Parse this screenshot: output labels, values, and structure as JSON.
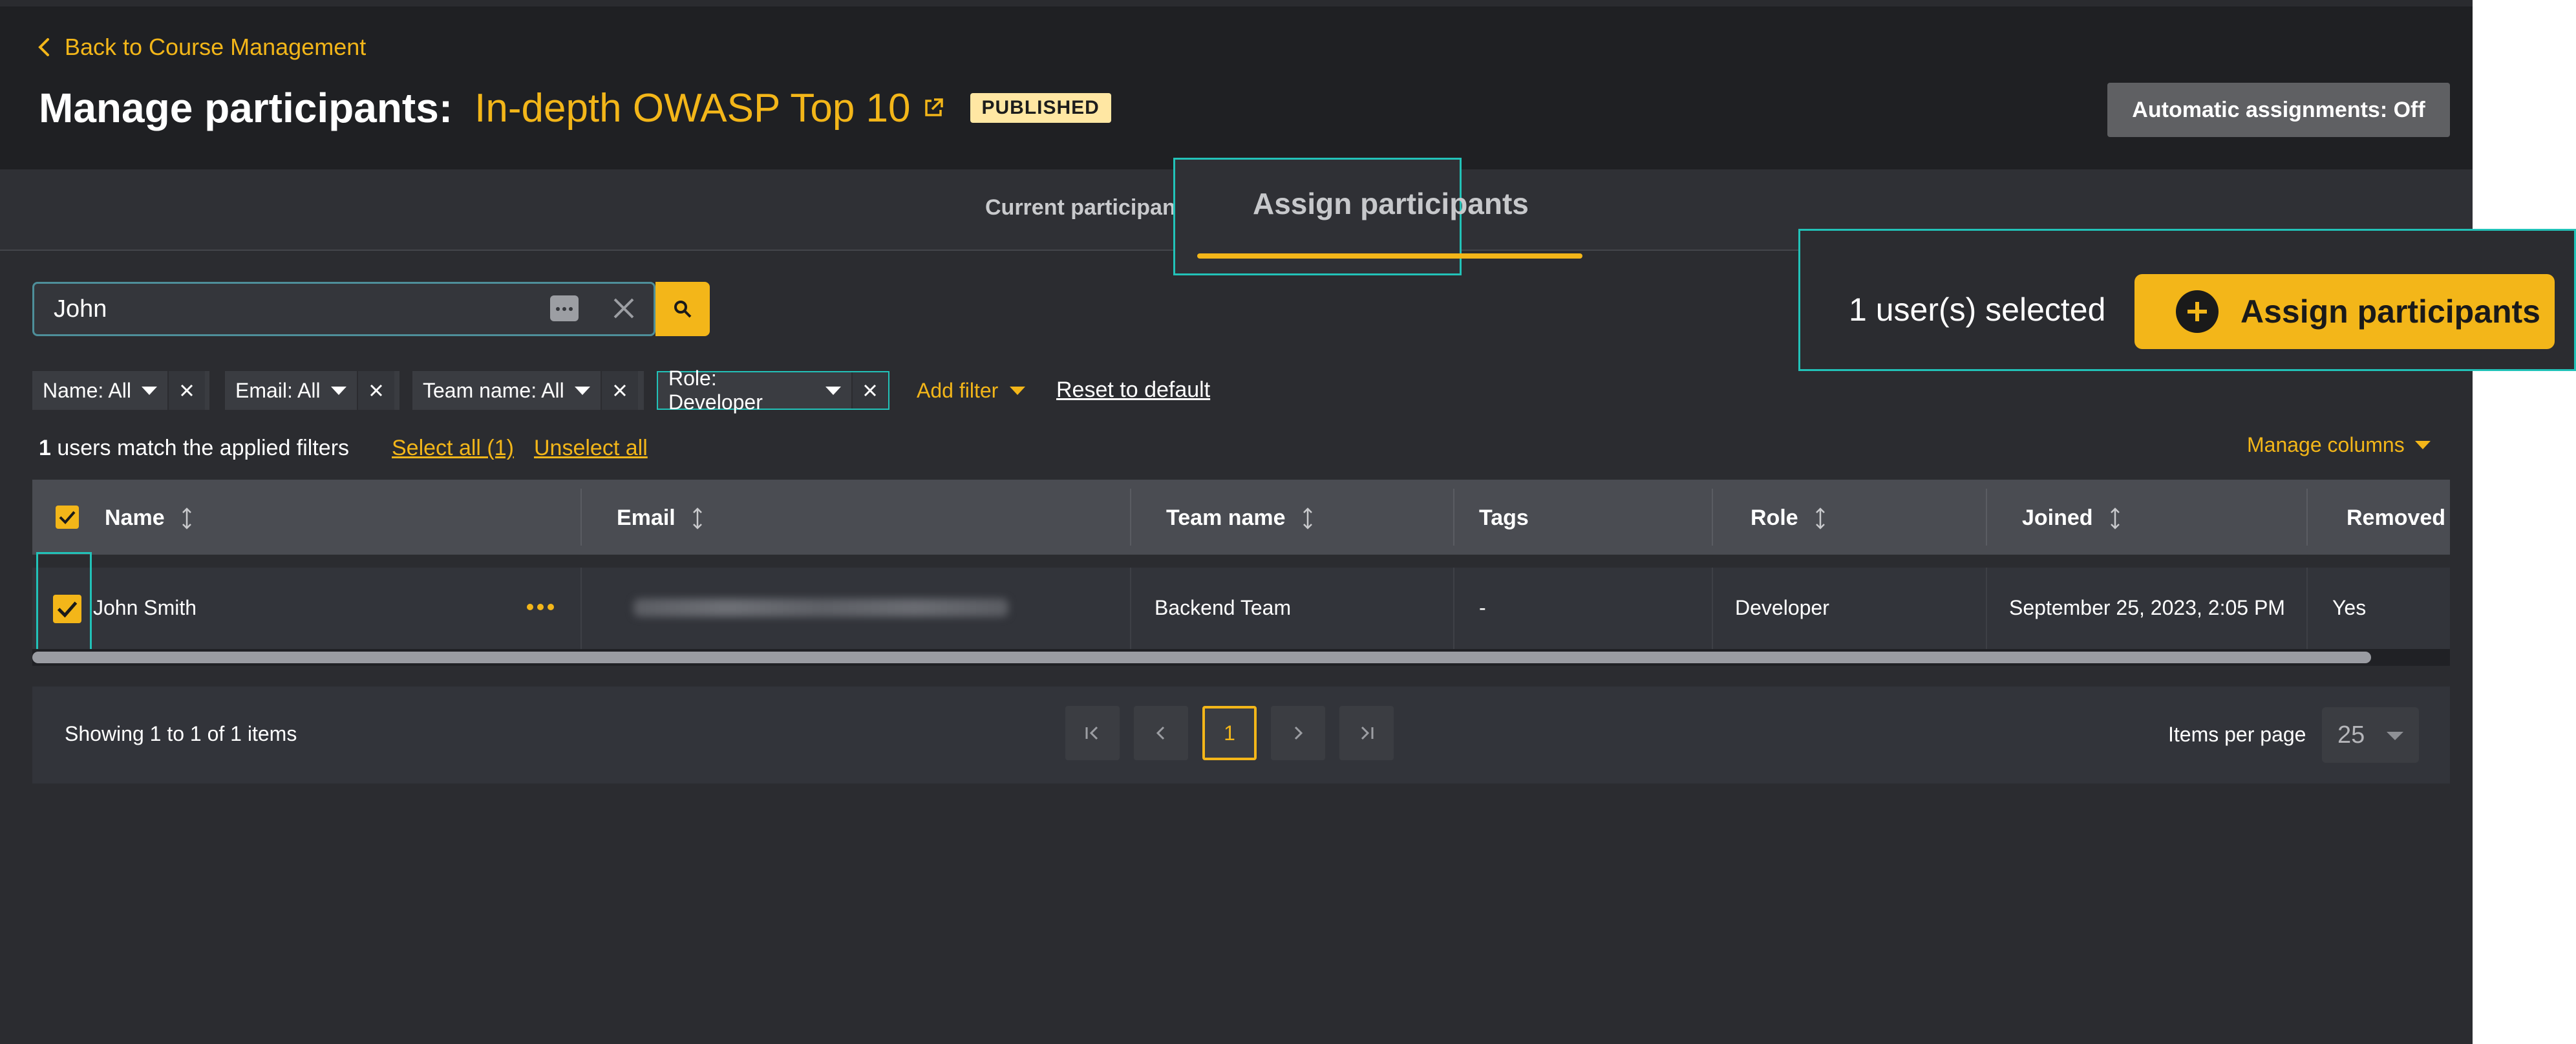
{
  "header": {
    "back_label": "Back to Course Management",
    "title": "Manage participants:",
    "course_name": "In-depth OWASP Top 10",
    "badge": "PUBLISHED",
    "auto_assign_label": "Automatic assignments: Off"
  },
  "tabs": {
    "current": "Current participants",
    "assign": "Assign participants"
  },
  "search": {
    "value": "John"
  },
  "filters": [
    {
      "label": "Name: All"
    },
    {
      "label": "Email: All"
    },
    {
      "label": "Team name: All"
    },
    {
      "label": "Role: Developer"
    }
  ],
  "add_filter": "Add filter",
  "reset": "Reset to default",
  "selection": {
    "selected_text": "1 user(s) selected",
    "assign_button": "Assign participants"
  },
  "results": {
    "count": "1",
    "text": " users match the applied filters",
    "select_all": "Select all (1)",
    "unselect_all": "Unselect all",
    "manage_columns": "Manage columns"
  },
  "table": {
    "columns": [
      "Name",
      "Email",
      "Team name",
      "Tags",
      "Role",
      "Joined",
      "Removed"
    ],
    "rows": [
      {
        "name": "John Smith",
        "team": "Backend Team",
        "tags": "-",
        "role": "Developer",
        "joined": "September 25, 2023, 2:05 PM",
        "removed": "Yes"
      }
    ]
  },
  "pagination": {
    "showing": "Showing 1 to 1 of 1 items",
    "current_page": "1",
    "items_per_page_label": "Items per page",
    "items_per_page": "25"
  },
  "colors": {
    "accent": "#f3b619",
    "highlight": "#22c2b8",
    "background": "#2b2c30"
  }
}
